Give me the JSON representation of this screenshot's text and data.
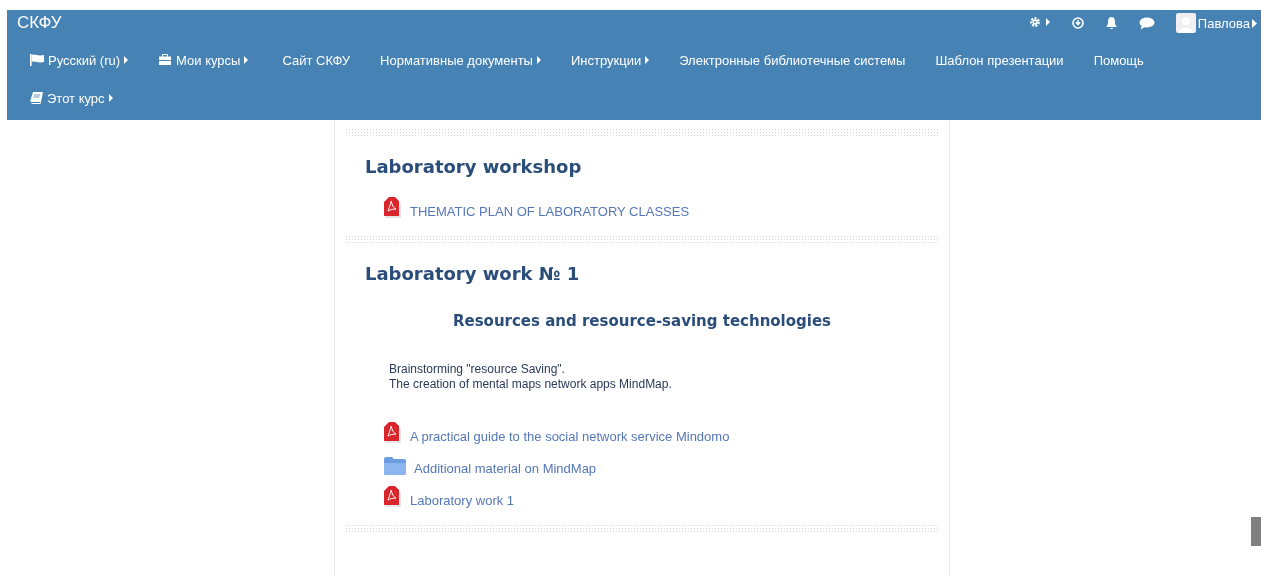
{
  "header": {
    "title": "СКФУ",
    "user": "Павлова"
  },
  "menu_rows": [
    [
      {
        "label": "Русский (ru)",
        "kind": "language",
        "has_menu": true
      },
      {
        "label": "Мои курсы",
        "kind": "courses",
        "has_menu": true
      },
      {
        "label": "Сайт СКФУ",
        "kind": "link",
        "has_menu": false
      },
      {
        "label": "Нормативные документы",
        "kind": "link",
        "has_menu": true
      },
      {
        "label": "Инструкции",
        "kind": "link",
        "has_menu": true
      },
      {
        "label": "Электронные библиотечные системы",
        "kind": "link",
        "has_menu": false
      },
      {
        "label": "Шаблон презентации",
        "kind": "link",
        "has_menu": false
      },
      {
        "label": "Помощь",
        "kind": "link",
        "has_menu": false
      }
    ],
    [
      {
        "label": "Этот курс",
        "kind": "course",
        "has_menu": true
      }
    ]
  ],
  "sections": [
    {
      "title": "Laboratory workshop",
      "resources": [
        {
          "kind": "pdf",
          "label": "THEMATIC PLAN OF LABORATORY CLASSES"
        }
      ]
    },
    {
      "title": "Laboratory work № 1",
      "subtitle": "Resources and resource-saving technologies",
      "description": [
        "Brainstorming \"resource Saving\".",
        "The creation of mental maps network apps MindMap."
      ],
      "resources": [
        {
          "kind": "pdf",
          "label": "A practical guide to the social network service Mindomo"
        },
        {
          "kind": "folder",
          "label": "Additional material on MindMap"
        },
        {
          "kind": "pdf",
          "label": "Laboratory work 1"
        }
      ]
    }
  ]
}
